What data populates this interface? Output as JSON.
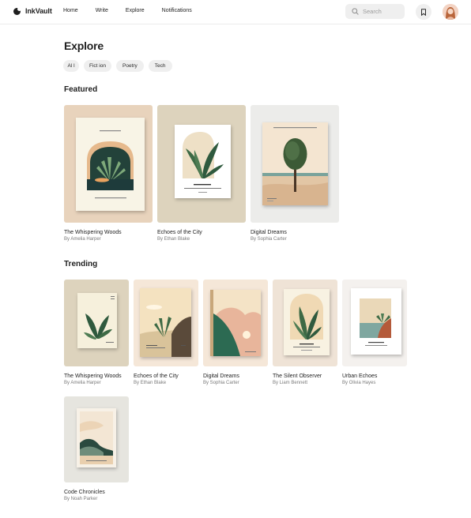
{
  "brand": {
    "name": "InkVault"
  },
  "nav": {
    "home": "Home",
    "write": "Write",
    "explore": "Explore",
    "notifications": "Notifications"
  },
  "search": {
    "placeholder": "Search"
  },
  "page": {
    "title": "Explore"
  },
  "filters": [
    {
      "label": "Al l"
    },
    {
      "label": "Fict ion"
    },
    {
      "label": "Poetry"
    },
    {
      "label": "Tech"
    }
  ],
  "sections": {
    "featured": "Featured",
    "trending": "Trending"
  },
  "featured": [
    {
      "title": "The Whispering Woods",
      "author": "By Amelia Harper"
    },
    {
      "title": "Echoes of the City",
      "author": "By Ethan Blake"
    },
    {
      "title": "Digital Dreams",
      "author": "By Sophia Carter"
    }
  ],
  "trending": [
    {
      "title": "The Whispering Woods",
      "author": "By Amelia Harper"
    },
    {
      "title": "Echoes of the City",
      "author": "By Ethan Blake"
    },
    {
      "title": "Digital Dreams",
      "author": "By Sophia Carter"
    },
    {
      "title": "The Silent Observer",
      "author": "By Liam Bennett"
    },
    {
      "title": "Urban Echoes",
      "author": "By Olivia Hayes"
    },
    {
      "title": "Code Chronicles",
      "author": "By Noah Parker"
    }
  ],
  "colors": {
    "cover_tan": "#e8d3bc",
    "cover_olive": "#ddd3bd",
    "cover_grey": "#ececea",
    "cover_cream": "#f5e7d8",
    "cover_light": "#f4f1ee",
    "leaf_green": "#2f5a3e"
  }
}
